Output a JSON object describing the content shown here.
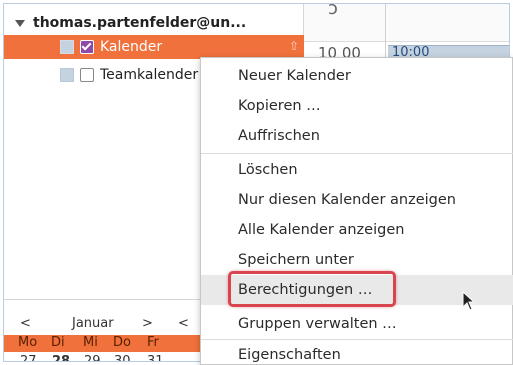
{
  "account": {
    "name": "thomas.partenfelder@un..."
  },
  "calendars": [
    {
      "label": "Kalender",
      "checked": true,
      "selected": true
    },
    {
      "label": "Teamkalender",
      "checked": false,
      "selected": false
    }
  ],
  "mini_month": {
    "prev": "<",
    "month": "Januar",
    "next": ">",
    "prev2": "<",
    "days": [
      "Mo",
      "Di",
      "Mi",
      "Do",
      "Fr"
    ],
    "dates": [
      "27",
      "28",
      "29",
      "30",
      "31"
    ]
  },
  "day_view": {
    "hour": "10 00",
    "event": "10:00"
  },
  "context_menu": {
    "items": [
      {
        "label": "Neuer Kalender"
      },
      {
        "label": "Kopieren …"
      },
      {
        "label": "Auffrischen"
      },
      {
        "label": "Löschen"
      },
      {
        "label": "Nur diesen Kalender anzeigen"
      },
      {
        "label": "Alle Kalender anzeigen"
      },
      {
        "label": "Speichern unter"
      },
      {
        "label": "Berechtigungen …",
        "hovered": true,
        "highlighted": true
      },
      {
        "label": "Gruppen verwalten …"
      },
      {
        "label": "Eigenschaften"
      }
    ]
  },
  "colors": {
    "selection": "#f0713b",
    "highlight_box": "#d9454f",
    "checkbox_checked": "#8e4aa8"
  }
}
